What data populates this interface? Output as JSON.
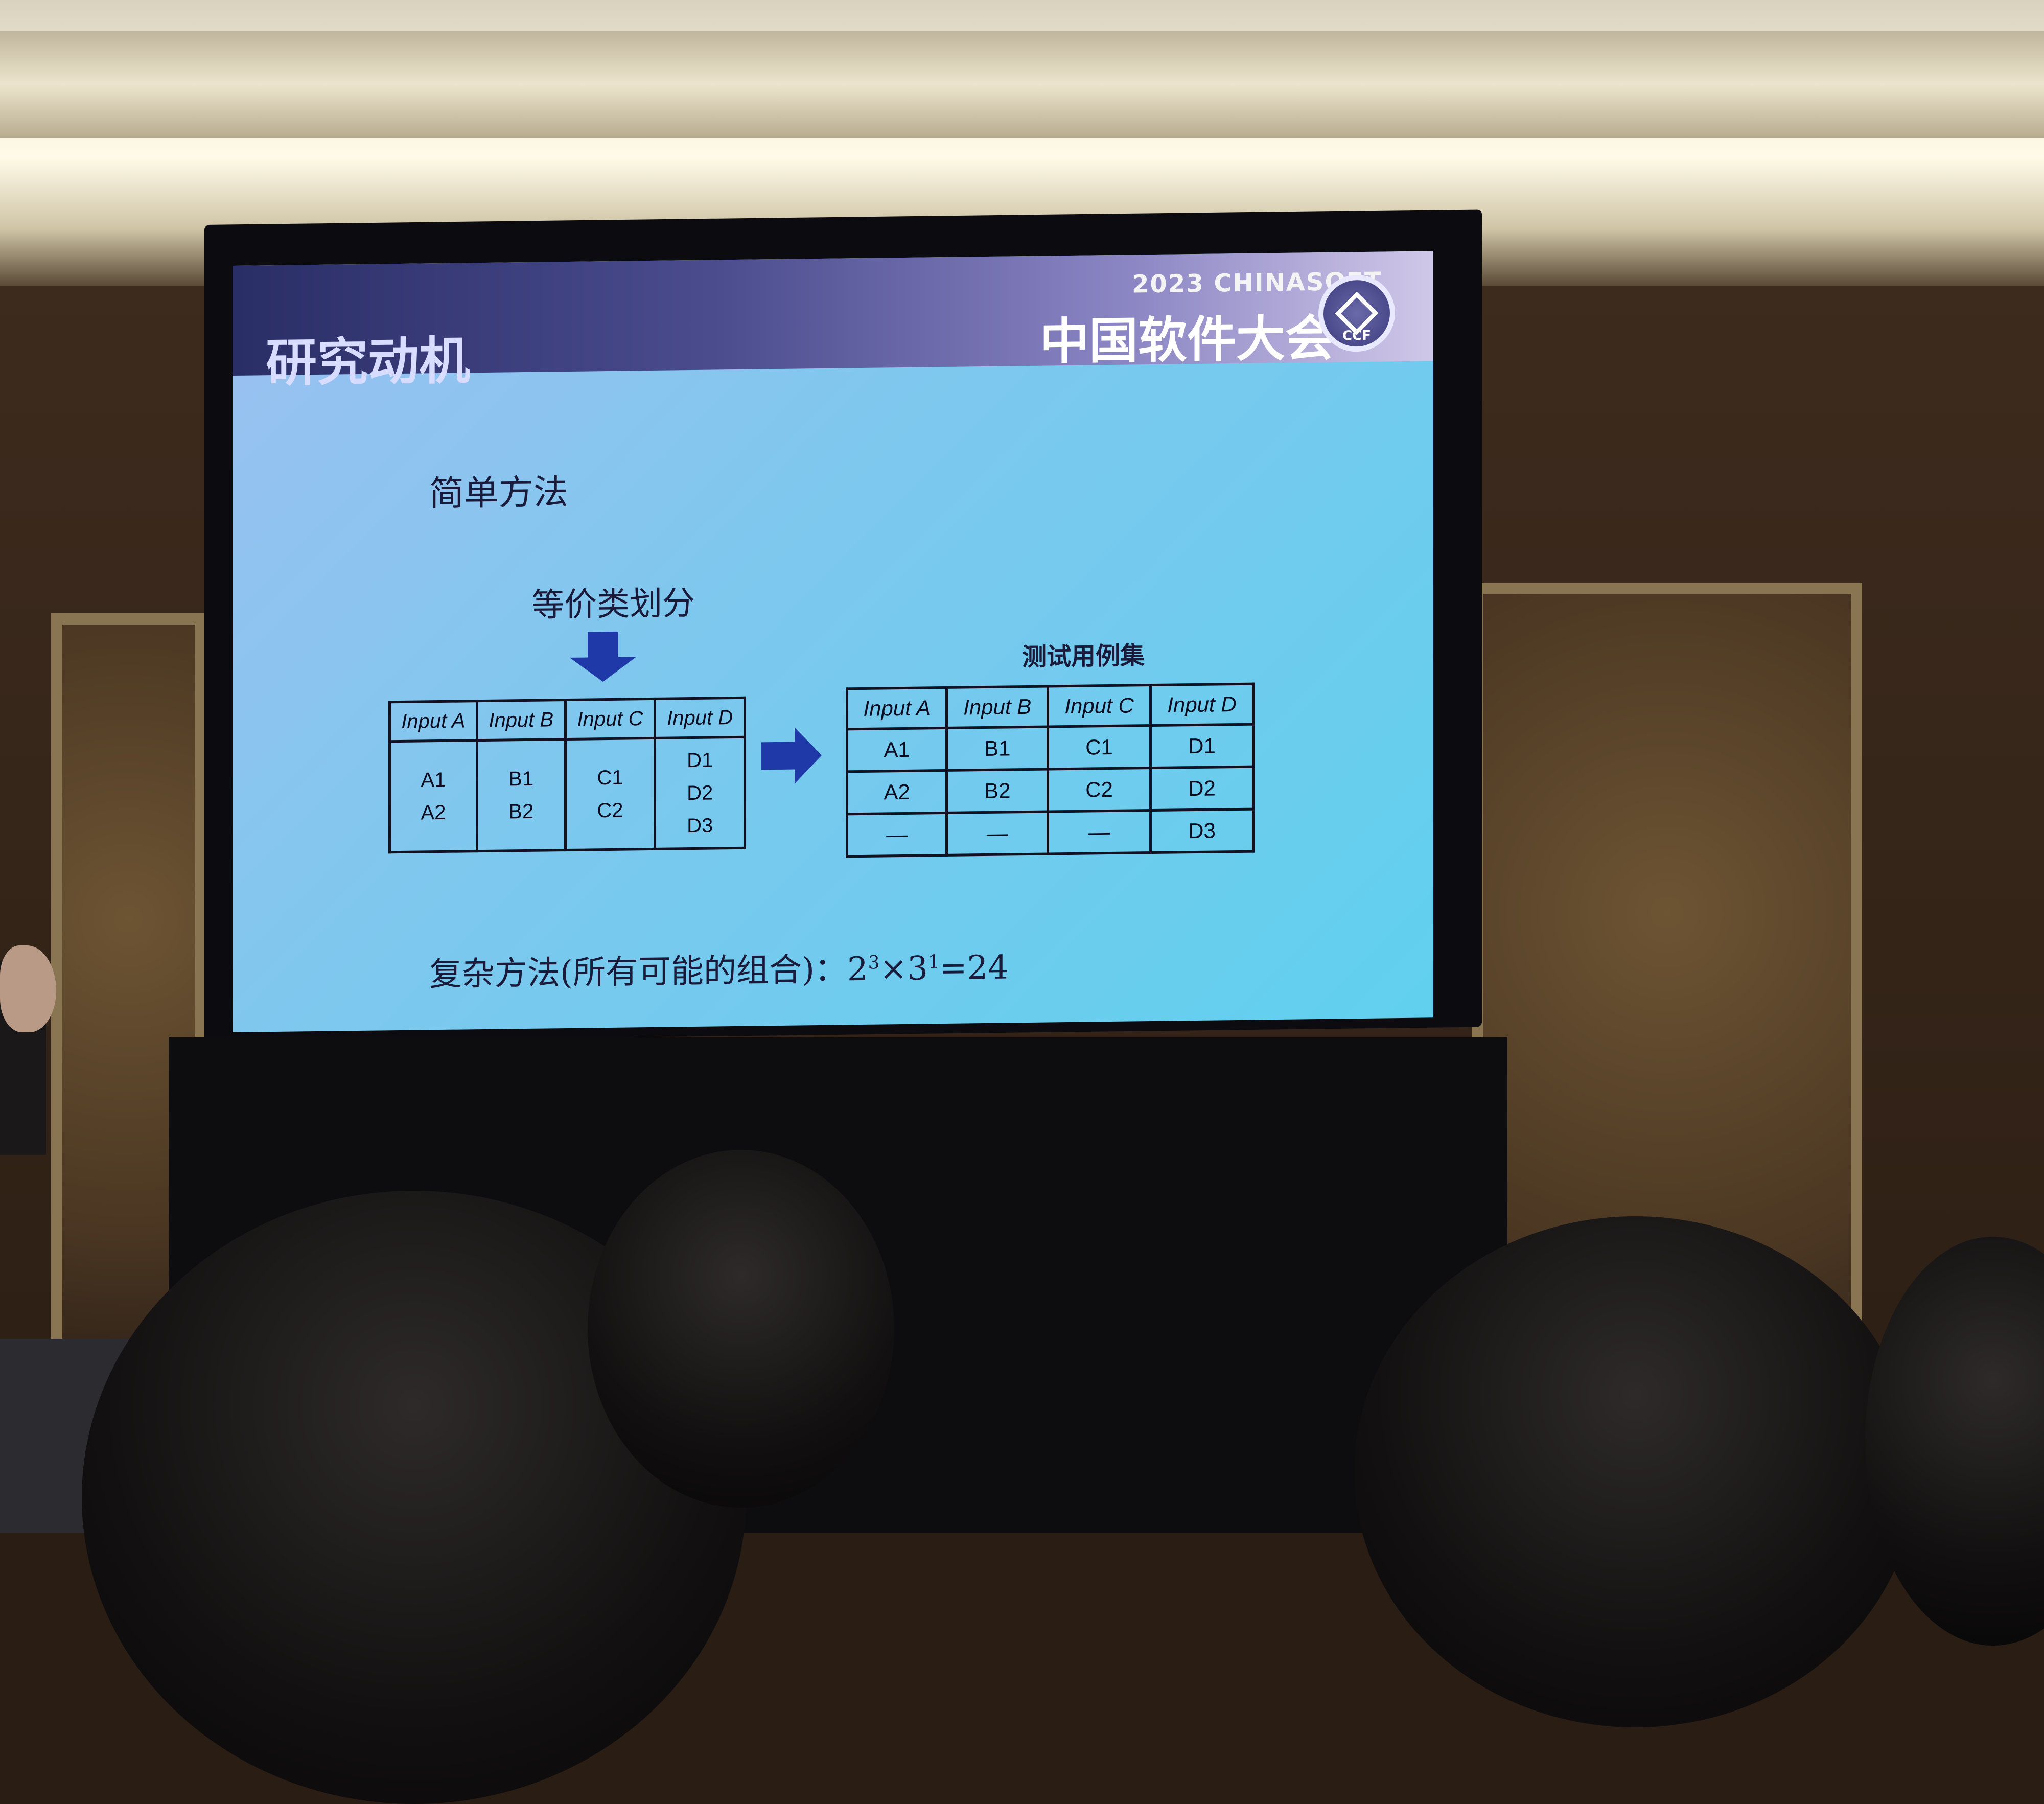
{
  "slide": {
    "title": "研究动机",
    "logo": {
      "year": "2023",
      "brand": "CHINASOFT",
      "name": "中国软件大会",
      "seal_text": "CCF"
    },
    "simple_method_label": "简单方法",
    "partition_label": "等价类划分",
    "input_table": {
      "headers": [
        "Input A",
        "Input B",
        "Input C",
        "Input D"
      ],
      "columns": [
        [
          "A1",
          "A2"
        ],
        [
          "B1",
          "B2"
        ],
        [
          "C1",
          "C2"
        ],
        [
          "D1",
          "D2",
          "D3"
        ]
      ]
    },
    "test_set_label": "测试用例集",
    "test_table": {
      "headers": [
        "Input A",
        "Input B",
        "Input C",
        "Input D"
      ],
      "rows": [
        [
          "A1",
          "B1",
          "C1",
          "D1"
        ],
        [
          "A2",
          "B2",
          "C2",
          "D2"
        ],
        [
          "—",
          "—",
          "—",
          "D3"
        ]
      ]
    },
    "complex_method": {
      "label": "复杂方法(所有可能的组合)：",
      "base1": "2",
      "exp1": "3",
      "times": "×",
      "base2": "3",
      "exp2": "1",
      "result": "=24"
    },
    "colors": {
      "header_dark": "#2a2e66",
      "slide_bg": "#7cc8ee",
      "arrow": "#1f3aa8"
    },
    "icons": [
      "down-arrow-icon",
      "right-arrow-icon"
    ]
  }
}
